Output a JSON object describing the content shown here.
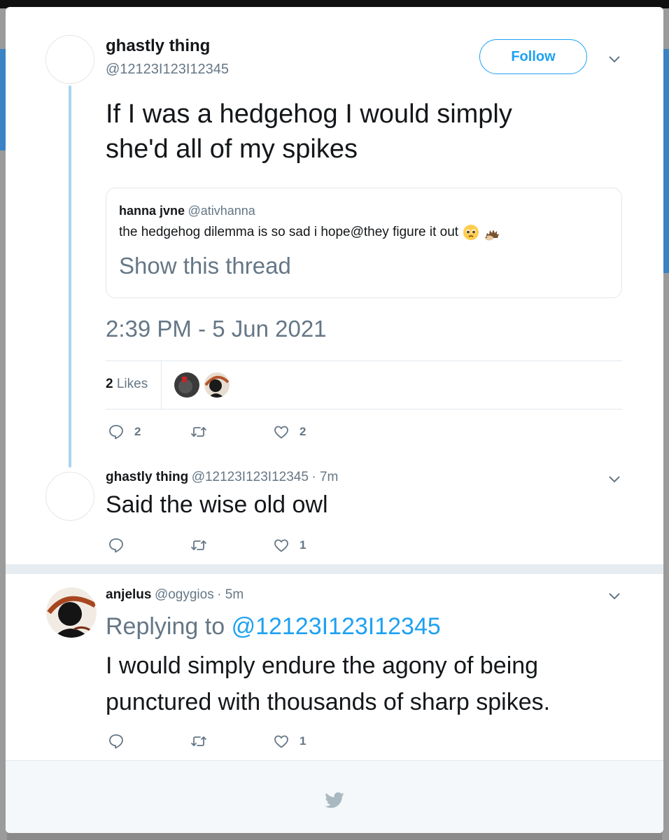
{
  "colors": {
    "accent": "#1da1f2",
    "muted": "#657786",
    "text": "#14171a",
    "thread_line": "#abd4f0"
  },
  "main_tweet": {
    "author_name": "ghastly thing",
    "author_handle": "@12123I123I12345",
    "follow_label": "Follow",
    "text_line1": "If I was a hedgehog I would simply",
    "text_line2": "she'd all of my spikes",
    "quote": {
      "author_name": "hanna jvne",
      "author_handle": "@ativhanna",
      "text": "the hedgehog dilemma is so sad i hope@they figure it out",
      "emojis": [
        "pleading-face-emoji",
        "hedgehog-emoji"
      ],
      "show_thread_label": "Show this thread"
    },
    "timestamp": "2:39 PM - 5 Jun 2021",
    "likes_count": "2",
    "likes_label": "Likes",
    "actions": {
      "replies": "2",
      "retweets": "",
      "likes": "2"
    }
  },
  "thread_reply": {
    "author_name": "ghastly thing",
    "author_handle": "@12123I123I12345",
    "time": "· 7m",
    "text": "Said the wise old owl",
    "actions": {
      "replies": "",
      "retweets": "",
      "likes": "1"
    }
  },
  "reply": {
    "author_name": "anjelus",
    "author_handle": "@ogygios",
    "time": "· 5m",
    "replying_prefix": "Replying to",
    "replying_handle": "@12123I123I12345",
    "text_line1": "I would simply endure the agony of being",
    "text_line2": "punctured with thousands of sharp spikes.",
    "actions": {
      "replies": "",
      "retweets": "",
      "likes": "1"
    }
  },
  "footer": {
    "icon": "twitter-bird-icon"
  }
}
